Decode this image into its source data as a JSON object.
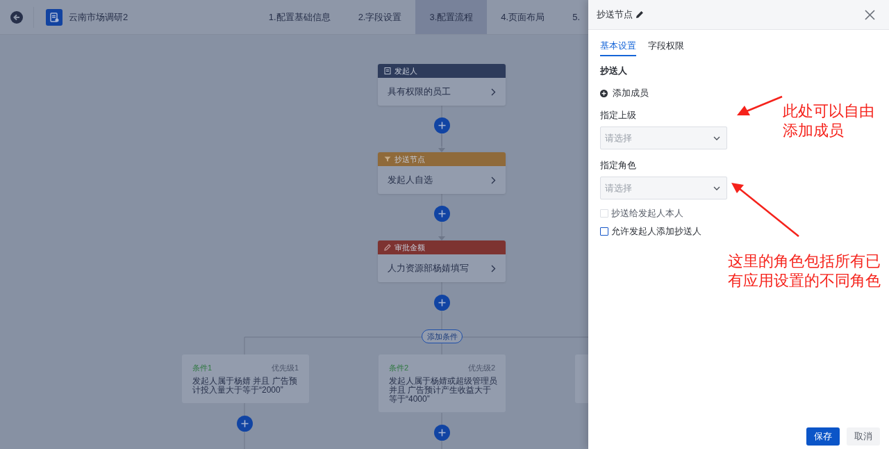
{
  "header": {
    "title": "云南市场调研2",
    "steps": [
      {
        "label": "1.配置基础信息",
        "selected": false
      },
      {
        "label": "2.字段设置",
        "selected": false
      },
      {
        "label": "3.配置流程",
        "selected": true
      },
      {
        "label": "4.页面布局",
        "selected": false
      },
      {
        "label": "5.",
        "selected": false
      }
    ]
  },
  "flow": {
    "nodes": [
      {
        "kind": "starter",
        "title": "发起人",
        "content": "具有权限的员工"
      },
      {
        "kind": "cc",
        "title": "抄送节点",
        "content": "发起人自选"
      },
      {
        "kind": "approval",
        "title": "审批金额",
        "content": "人力资源部杨婧填写"
      }
    ],
    "add_condition": "添加条件",
    "conditions": [
      {
        "name": "条件1",
        "priority": "优先级1",
        "text": "发起人属于杨婧 并且 广告预计投入量大于等于“2000”"
      },
      {
        "name": "条件2",
        "priority": "优先级2",
        "text": "发起人属于杨婧或超级管理员并且 广告预计产生收益大于等于“4000”"
      }
    ]
  },
  "panel": {
    "title": "抄送节点",
    "tabs": [
      {
        "label": "基本设置",
        "selected": true
      },
      {
        "label": "字段权限",
        "selected": false
      }
    ],
    "section": "抄送人",
    "add_member": "添加成员",
    "fields": [
      {
        "label": "指定上级",
        "placeholder": "请选择"
      },
      {
        "label": "指定角色",
        "placeholder": "请选择"
      }
    ],
    "options": [
      {
        "label": "抄送给发起人本人",
        "checked": false,
        "disabled": true
      },
      {
        "label": "允许发起人添加抄送人",
        "checked": false,
        "disabled": false
      }
    ],
    "buttons": [
      {
        "label": "保存",
        "kind": "primary"
      },
      {
        "label": "取消",
        "kind": "secondary"
      }
    ]
  },
  "annotations": [
    {
      "text": "此处可以自由添加成员"
    },
    {
      "text": "这里的角色包括所有已有应用设置的不同角色"
    }
  ]
}
